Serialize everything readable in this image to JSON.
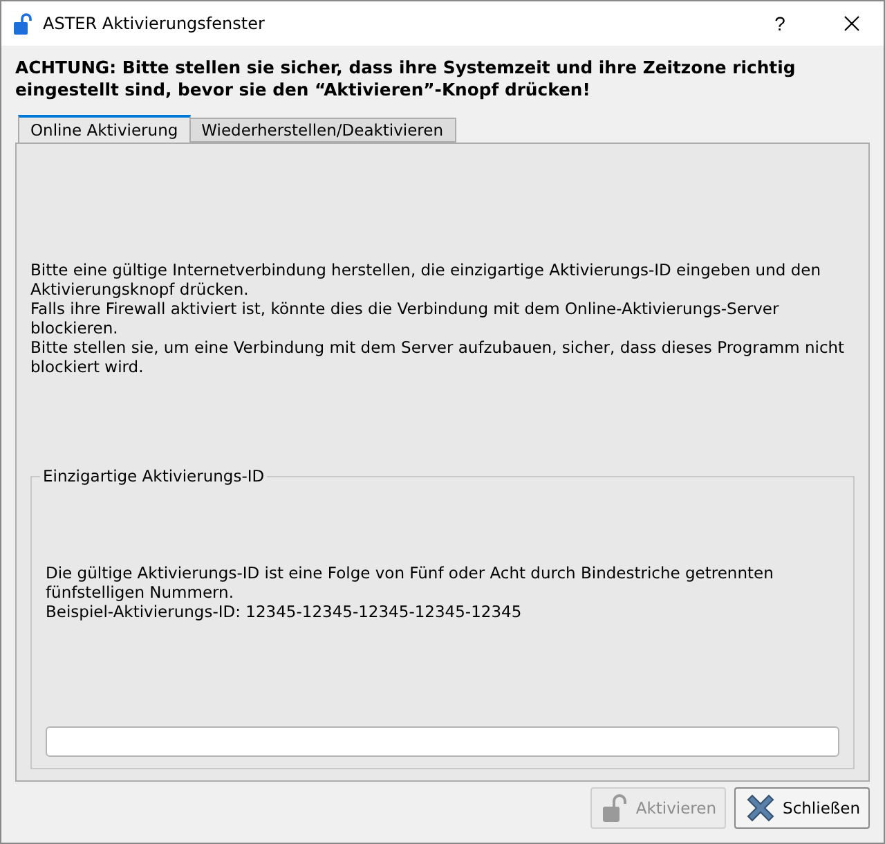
{
  "window": {
    "title": "ASTER Aktivierungsfenster",
    "help": "?"
  },
  "warning": "ACHTUNG: Bitte stellen sie sicher, dass ihre Systemzeit und ihre Zeitzone richtig eingestellt sind, bevor sie den “Aktivieren”-Knopf drücken!",
  "tabs": [
    {
      "label": "Online Aktivierung",
      "selected": true
    },
    {
      "label": "Wiederherstellen/Deaktivieren",
      "selected": false
    }
  ],
  "instructions": [
    "Bitte eine gültige Internetverbindung herstellen, die einzigartige Aktivierungs-ID eingeben und den Aktivierungsknopf drücken.",
    "Falls ihre Firewall aktiviert ist, könnte dies die Verbindung mit dem Online-Aktivierungs-Server blockieren.",
    "Bitte stellen sie, um eine Verbindung mit dem Server aufzubauen, sicher, dass dieses Programm nicht blockiert wird."
  ],
  "id_group": {
    "title": "Einzigartige Aktivierungs-ID",
    "hint": [
      "Die gültige Aktivierungs-ID ist eine Folge von Fünf oder Acht durch Bindestriche getrennten fünfstelligen Nummern.",
      "Beispiel-Aktivierungs-ID: 12345-12345-12345-12345-12345"
    ]
  },
  "buttons": [
    {
      "kind": "activate",
      "label": "Aktivieren",
      "disabled": true
    },
    {
      "kind": "close",
      "label": "Schließen",
      "disabled": false
    }
  ]
}
